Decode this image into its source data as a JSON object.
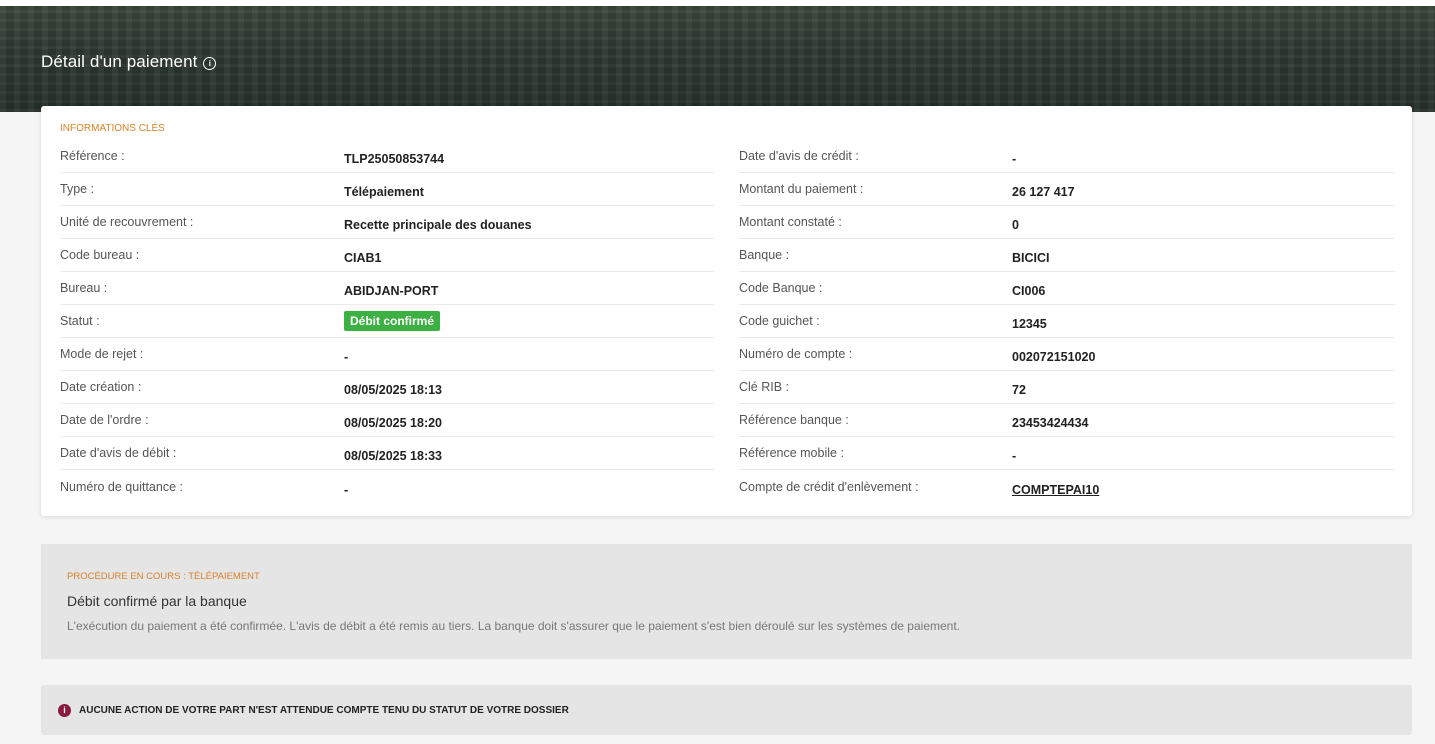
{
  "header": {
    "title": "Détail d'un paiement",
    "info_icon": "info-circle-icon"
  },
  "key_info": {
    "section_label": "INFORMATIONS CLÉS",
    "left": [
      {
        "label": "Référence :",
        "value": "TLP25050853744"
      },
      {
        "label": "Type :",
        "value": "Télépaiement"
      },
      {
        "label": "Unité de recouvrement :",
        "value": "Recette principale des douanes"
      },
      {
        "label": "Code bureau :",
        "value": "CIAB1"
      },
      {
        "label": "Bureau :",
        "value": "ABIDJAN-PORT"
      },
      {
        "label": "Statut :",
        "value": "Débit confirmé",
        "badge_color": "#3cb043"
      },
      {
        "label": "Mode de rejet :",
        "value": "-"
      },
      {
        "label": "Date création :",
        "value": "08/05/2025 18:13"
      },
      {
        "label": "Date de l'ordre :",
        "value": "08/05/2025 18:20"
      },
      {
        "label": "Date d'avis de débit :",
        "value": "08/05/2025 18:33"
      },
      {
        "label": "Numéro de quittance :",
        "value": "-"
      }
    ],
    "right": [
      {
        "label": "Date d'avis de crédit :",
        "value": "-"
      },
      {
        "label": "Montant du paiement :",
        "value": "26 127 417"
      },
      {
        "label": "Montant constaté :",
        "value": "0"
      },
      {
        "label": "Banque :",
        "value": "BICICI"
      },
      {
        "label": "Code Banque :",
        "value": "CI006"
      },
      {
        "label": "Code guichet :",
        "value": "12345"
      },
      {
        "label": "Numéro de compte :",
        "value": "002072151020"
      },
      {
        "label": "Clé RIB :",
        "value": "72"
      },
      {
        "label": "Référence banque :",
        "value": "23453424434"
      },
      {
        "label": "Référence mobile :",
        "value": "-"
      },
      {
        "label": "Compte de crédit d'enlèvement :",
        "value": "COMPTEPAI10"
      }
    ]
  },
  "procedure": {
    "label": "PROCÉDURE EN COURS : TÉLÉPAIEMENT",
    "title": "Débit confirmé par la banque",
    "description": "L'exécution du paiement a été confirmée. L'avis de débit a été remis au tiers. La banque doit s'assurer que le paiement s'est bien déroulé sur les systèmes de paiement."
  },
  "notice": {
    "icon": "info-circle-icon",
    "text": "AUCUNE ACTION DE VOTRE PART N'EST ATTENDUE COMPTE TENU DU STATUT DE VOTRE DOSSIER",
    "icon_color": "#8b1a3f"
  },
  "colors": {
    "accent": "#d9822b",
    "status_green": "#3cb043"
  }
}
